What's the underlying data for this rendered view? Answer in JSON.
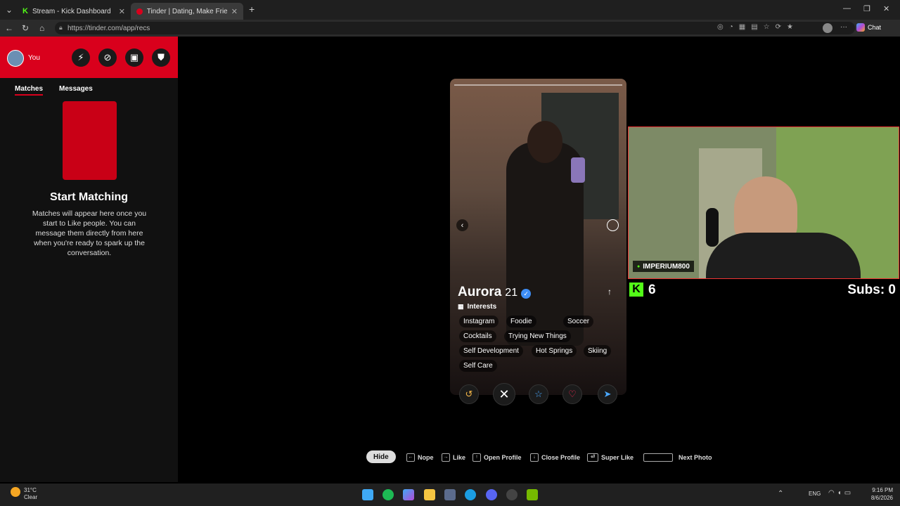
{
  "browser": {
    "tabs": [
      {
        "title": "Stream - Kick Dashboard",
        "active": false
      },
      {
        "title": "Tinder | Dating, Make Friends & M",
        "active": true
      }
    ],
    "url": "https://tinder.com/app/recs",
    "chat_label": "Chat"
  },
  "sidebar": {
    "user_label": "You",
    "tabs": [
      "Matches",
      "Messages"
    ],
    "empty_title": "Start Matching",
    "empty_text": "Matches will appear here once you start to Like people. You can message them directly from here when you're ready to spark up the conversation."
  },
  "profile": {
    "name": "Aurora",
    "age": "21",
    "interests_label": "Interests",
    "interests": [
      "Instagram",
      "Foodie",
      "Soccer",
      "Cocktails",
      "Trying New Things",
      "Self Development",
      "Hot Springs",
      "Skiing",
      "Self Care"
    ]
  },
  "hints": {
    "hide": "Hide",
    "nope": "Nope",
    "like": "Like",
    "open_profile": "Open Profile",
    "close_profile": "Close Profile",
    "super_like": "Super Like",
    "next_photo": "Next Photo"
  },
  "overlay": {
    "streamer_tag": "IMPERIUM800",
    "viewer_count": "6",
    "subs": "Subs: 0"
  },
  "taskbar": {
    "weather_temp": "31°C",
    "weather_desc": "Clear",
    "lang": "ENG",
    "time": "9:16 PM",
    "date": "8/6/2026"
  },
  "colors": {
    "tinder_red": "#d9001c",
    "kick_green": "#53fc18",
    "like_red": "#ff2d55"
  }
}
